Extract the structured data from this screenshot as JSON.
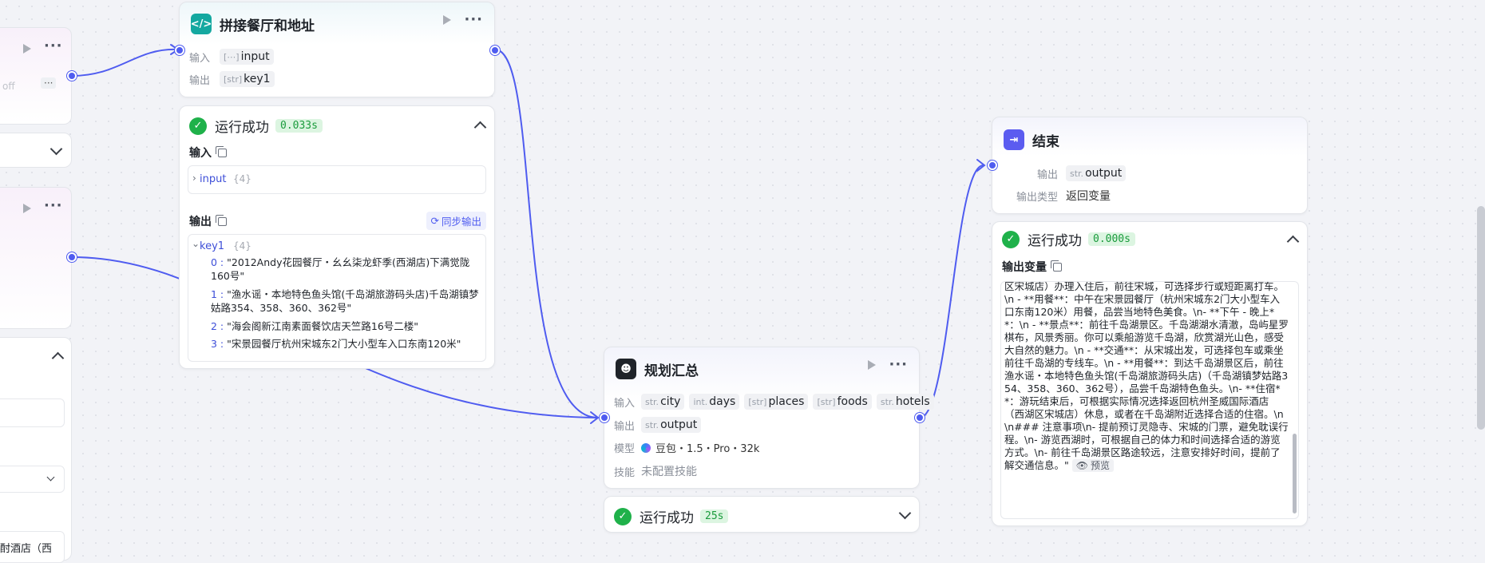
{
  "left_fragments": {
    "partial_text_off": "off",
    "dots_label": "···",
    "partial_hotel": "酎酒店（西"
  },
  "node_concat": {
    "title": "拼接餐厅和地址",
    "input_label": "输入",
    "output_label": "输出",
    "input_type": "[⋯]",
    "input_name": "input",
    "output_type": "[str]",
    "output_name": "key1"
  },
  "run_concat": {
    "status": "运行成功",
    "time": "0.033s",
    "input_title": "输入",
    "input_var": "input",
    "input_count": "{4}",
    "output_title": "输出",
    "sync_label": "同步输出",
    "output_var": "key1",
    "output_count": "{4}",
    "items": [
      {
        "idx": "0 :",
        "text": "\"2012Andy花园餐厅・幺幺柒龙虾季(西湖店)下满觉陇160号\""
      },
      {
        "idx": "1 :",
        "text": "\"渔水谣・本地特色鱼头馆(千岛湖旅游码头店)千岛湖镇梦姑路354、358、360、362号\""
      },
      {
        "idx": "2 :",
        "text": "\"海会阁新江南素面餐饮店天竺路16号二楼\""
      },
      {
        "idx": "3 :",
        "text": "\"宋景园餐厅杭州宋城东2门大小型车入口东南120米\""
      }
    ]
  },
  "node_summary": {
    "title": "规划汇总",
    "input_label": "输入",
    "output_label": "输出",
    "model_label": "模型",
    "skill_label": "技能",
    "inputs": [
      {
        "type": "str.",
        "name": "city"
      },
      {
        "type": "int.",
        "name": "days"
      },
      {
        "type": "[str]",
        "name": "places"
      },
      {
        "type": "[str]",
        "name": "foods"
      },
      {
        "type": "str.",
        "name": "hotels"
      }
    ],
    "output_type": "str.",
    "output_name": "output",
    "model": "豆包・1.5・Pro・32k",
    "skill": "未配置技能"
  },
  "run_summary": {
    "status": "运行成功",
    "time": "25s"
  },
  "node_end": {
    "title": "结束",
    "output_label": "输出",
    "output_type": "str.",
    "output_name": "output",
    "output_kind_label": "输出类型",
    "output_kind_value": "返回变量"
  },
  "run_end": {
    "status": "运行成功",
    "time": "0.000s",
    "var_title": "输出变量",
    "text": "区宋城店）办理入住后，前往宋城，可选择步行或短距离打车。\\n - **用餐**：中午在宋景园餐厅（杭州宋城东2门大小型车入口东南120米）用餐，品尝当地特色美食。\\n- **下午 - 晚上**：\\n - **景点**：前往千岛湖景区。千岛湖湖水清澈，岛屿星罗棋布，风景秀丽。你可以乘船游览千岛湖，欣赏湖光山色，感受大自然的魅力。\\n - **交通**：从宋城出发，可选择包车或乘坐前往千岛湖的专线车。\\n - **用餐**：到达千岛湖景区后，前往渔水谣・本地特色鱼头馆(千岛湖旅游码头店)（千岛湖镇梦姑路354、358、360、362号），品尝千岛湖特色鱼头。\\n- **住宿**：游玩结束后，可根据实际情况选择返回杭州圣威国际酒店（西湖区宋城店）休息，或者在千岛湖附近选择合适的住宿。\\n\\n### 注意事项\\n- 提前预订灵隐寺、宋城的门票，避免耽误行程。\\n- 游览西湖时，可根据自己的体力和时间选择合适的游览方式。\\n- 前往千岛湖景区路途较远，注意安排好时间，提前了解交通信息。\"",
    "preview_label": "预览"
  },
  "colors": {
    "handle": "#4f5cf0",
    "success": "#1fb14a",
    "code_icon": "#14a8a0",
    "end_icon": "#5b5cf0"
  }
}
